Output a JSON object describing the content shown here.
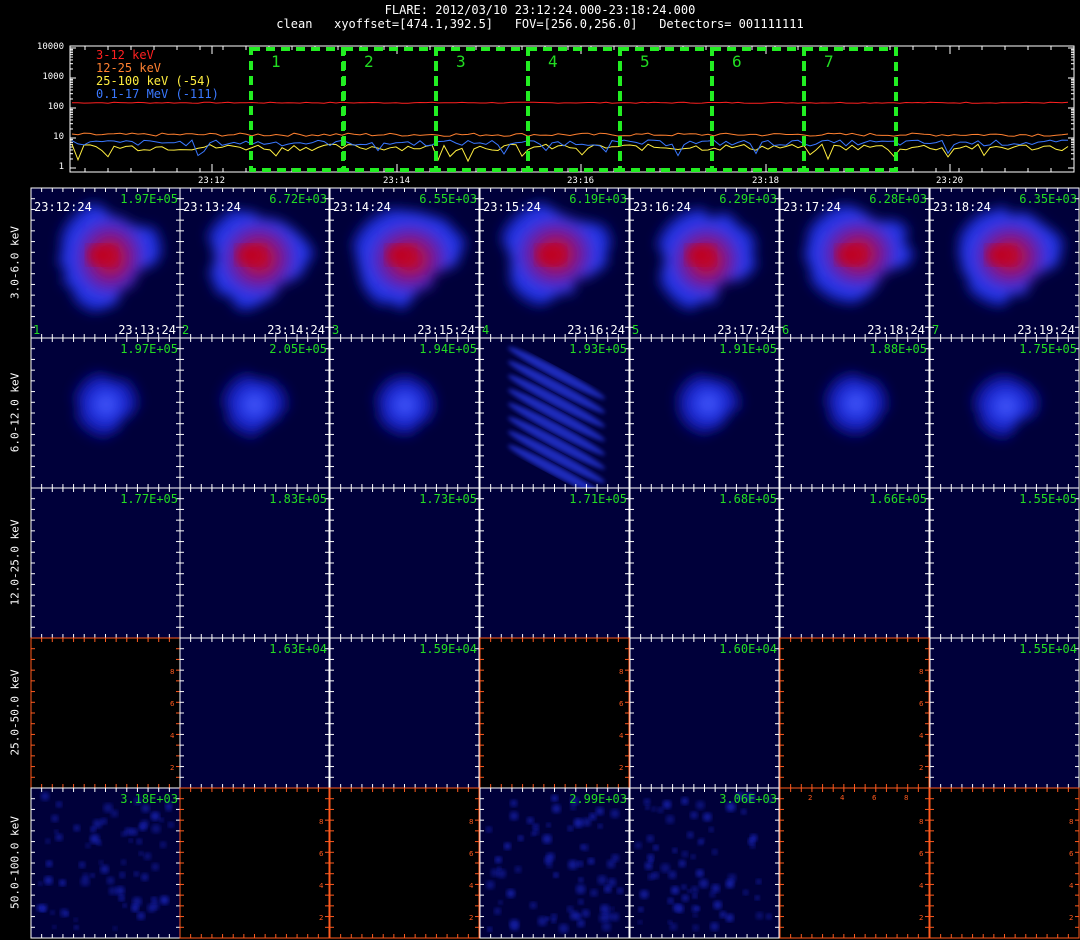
{
  "header": {
    "title": "FLARE: 2012/03/10 23:12:24.000-23:18:24.000",
    "subtitle": "clean   xyoffset=[474.1,392.5]   FOV=[256.0,256.0]   Detectors= 001111111"
  },
  "lightcurve": {
    "legend": [
      {
        "label": "3-12 keV",
        "color": "#ff2020"
      },
      {
        "label": "12-25 keV",
        "color": "#ff8030"
      },
      {
        "label": "25-100 keV (-54)",
        "color": "#ffee40"
      },
      {
        "label": "0.1-17 MeV (-111)",
        "color": "#3a78ff"
      }
    ],
    "y_ticks": [
      "10000",
      "1000",
      "100",
      "10",
      "1"
    ],
    "x_ticks": [
      "23:12",
      "23:14",
      "23:16",
      "23:18",
      "23:20"
    ],
    "intervals": [
      "1",
      "2",
      "3",
      "4",
      "5",
      "6",
      "7"
    ],
    "interval_color": "#22ee22"
  },
  "energy_bands": [
    {
      "label": "3.0-6.0 keV",
      "values": [
        "1.97E+05",
        "6.72E+03",
        "6.55E+03",
        "6.19E+03",
        "6.29E+03",
        "6.28E+03",
        "6.35E+03"
      ],
      "style": "big"
    },
    {
      "label": "6.0-12.0 keV",
      "values": [
        "1.97E+05",
        "2.05E+05",
        "1.94E+05",
        "1.93E+05",
        "1.91E+05",
        "1.88E+05",
        "1.75E+05"
      ],
      "style": "blob"
    },
    {
      "label": "12.0-25.0 keV",
      "values": [
        "1.77E+05",
        "1.83E+05",
        "1.73E+05",
        "1.71E+05",
        "1.68E+05",
        "1.66E+05",
        "1.55E+05"
      ],
      "style": "dark"
    },
    {
      "label": "25.0-50.0 keV",
      "values": [
        "",
        "1.63E+04",
        "1.59E+04",
        "",
        "1.60E+04",
        "",
        "1.55E+04"
      ],
      "style": "mixed"
    },
    {
      "label": "50.0-100.0 keV",
      "values": [
        "3.18E+03",
        "",
        "",
        "2.99E+03",
        "3.06E+03",
        "",
        ""
      ],
      "style": "speckle"
    }
  ],
  "row1_times": {
    "start": [
      "23:12:24",
      "23:13:24",
      "23:14:24",
      "23:15:24",
      "23:16:24",
      "23:17:24",
      "23:18:24"
    ],
    "end": [
      "23:13:24",
      "23:14:24",
      "23:15:24",
      "23:16:24",
      "23:17:24",
      "23:18:24",
      "23:19:24"
    ],
    "index": [
      "1",
      "2",
      "3",
      "4",
      "5",
      "6",
      "7"
    ]
  },
  "empty_axis_ticks": [
    "2",
    "4",
    "6",
    "8"
  ],
  "colors": {
    "label_green": "#22dd22",
    "axis_orange": "#ff5a1e",
    "image_bg": "#00003a"
  }
}
